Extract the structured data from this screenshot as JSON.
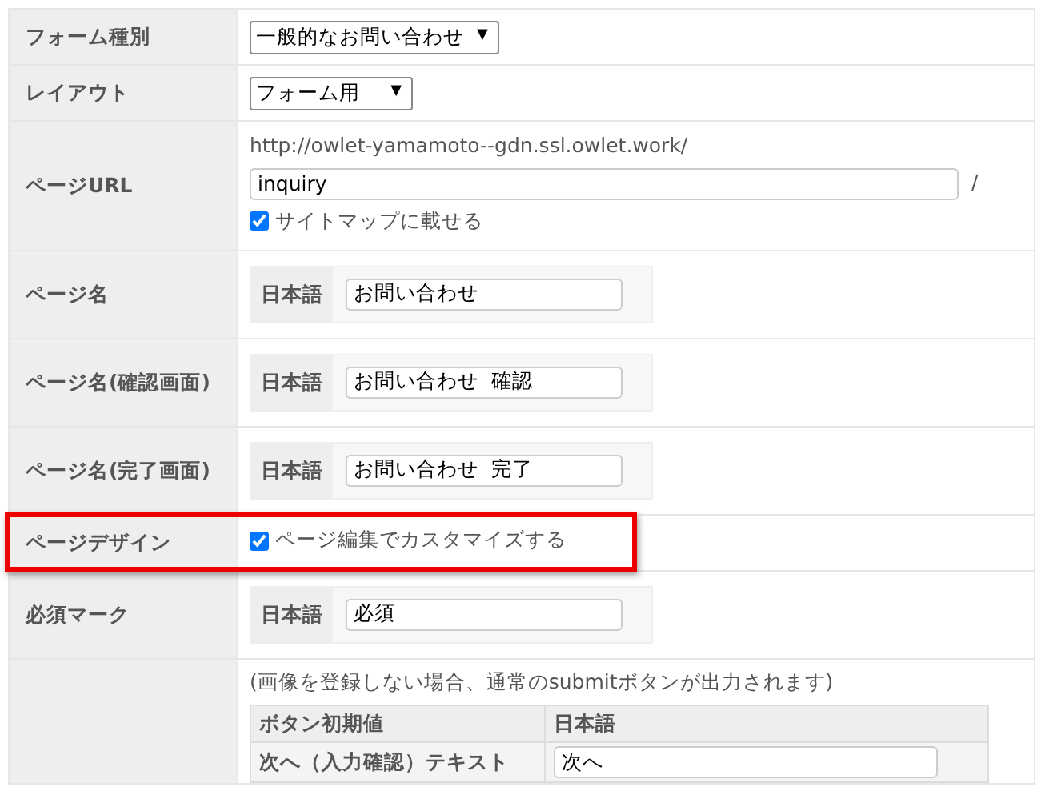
{
  "rows": [
    {
      "label": "フォーム種別",
      "kind": "select",
      "value": "一般的なお問い合わせ",
      "caret": "▼"
    },
    {
      "label": "レイアウト",
      "kind": "select",
      "value": "フォーム用",
      "caret": "▼"
    },
    {
      "label": "ページURL",
      "kind": "url",
      "base_url": "http://owlet-yamamoto--gdn.ssl.owlet.work/",
      "value": "inquiry",
      "suffix": "/",
      "checkbox": {
        "label": "サイトマップに載せる",
        "checked": true
      }
    },
    {
      "label": "ページ名",
      "kind": "lang",
      "lang": "日本語",
      "value": "お問い合わせ"
    },
    {
      "label": "ページ名(確認画面)",
      "kind": "lang",
      "lang": "日本語",
      "value": "お問い合わせ  確認"
    },
    {
      "label": "ページ名(完了画面)",
      "kind": "lang",
      "lang": "日本語",
      "value": "お問い合わせ  完了"
    },
    {
      "label": "ページデザイン",
      "kind": "checkbox",
      "highlighted": true,
      "checkbox": {
        "label": "ページ編集でカスタマイズする",
        "checked": true
      }
    },
    {
      "label": "必須マーク",
      "kind": "lang",
      "lang": "日本語",
      "value": "必須"
    },
    {
      "kind": "buttons",
      "note": "(画像を登録しない場合、通常のsubmitボタンが出力されます)",
      "columns": [
        "ボタン初期値",
        "日本語"
      ],
      "items": [
        {
          "label": "次へ（入力確認）テキスト",
          "value": "次へ"
        }
      ]
    }
  ]
}
